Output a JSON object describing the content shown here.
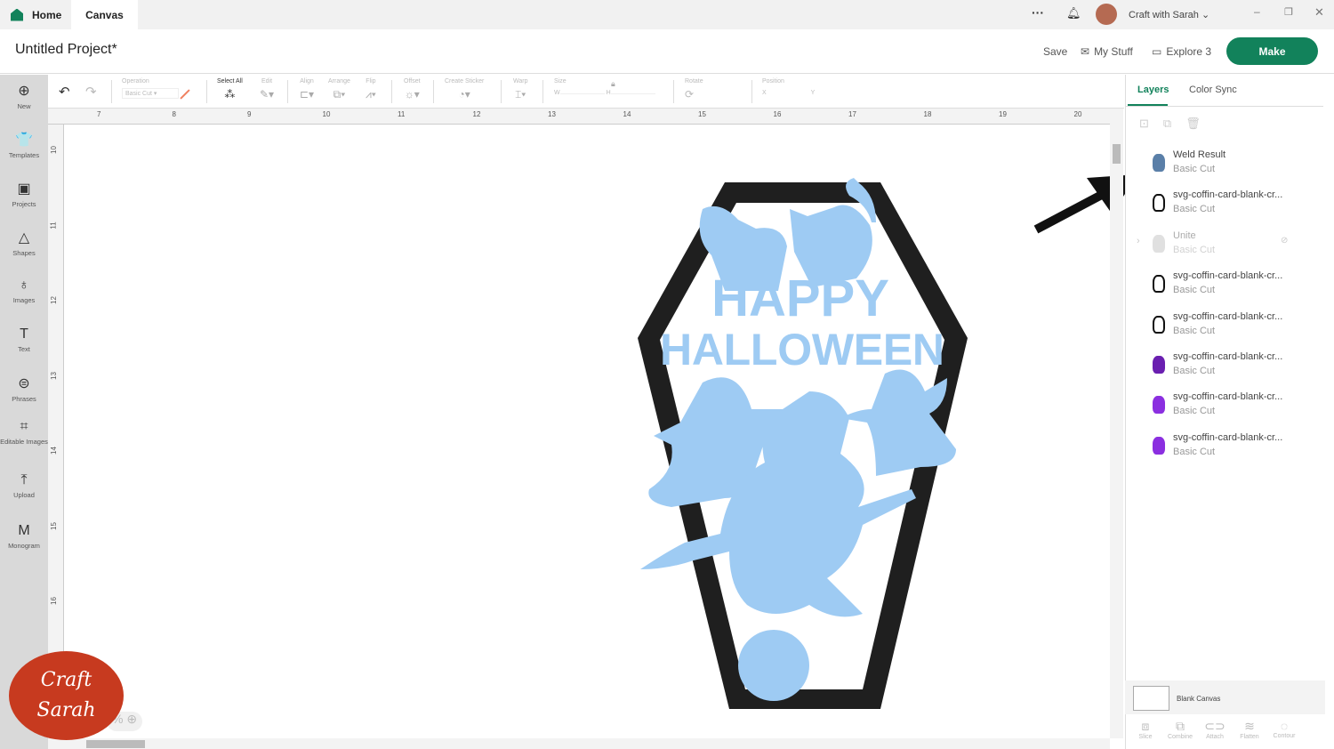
{
  "topbar": {
    "home": "Home",
    "canvas": "Canvas",
    "user": "Craft with Sarah"
  },
  "header": {
    "title": "Untitled Project*",
    "save": "Save",
    "my_stuff": "My Stuff",
    "machine": "Explore 3",
    "make": "Make"
  },
  "toolbar": {
    "operation": "Operation",
    "operation_value": "Basic Cut",
    "select_all": "Select All",
    "edit": "Edit",
    "align": "Align",
    "arrange": "Arrange",
    "flip": "Flip",
    "offset": "Offset",
    "create_sticker": "Create Sticker",
    "warp": "Warp",
    "size": "Size",
    "w": "W",
    "h": "H",
    "rotate": "Rotate",
    "position": "Position",
    "x": "X",
    "y": "Y"
  },
  "sidebar": {
    "items": [
      {
        "label": "New",
        "icon": "⊕"
      },
      {
        "label": "Templates",
        "icon": "👕"
      },
      {
        "label": "Projects",
        "icon": "▣"
      },
      {
        "label": "Shapes",
        "icon": "△"
      },
      {
        "label": "Images",
        "icon": "♁"
      },
      {
        "label": "Text",
        "icon": "T"
      },
      {
        "label": "Phrases",
        "icon": "⊜"
      },
      {
        "label": "Editable Images",
        "icon": "⌗"
      },
      {
        "label": "Upload",
        "icon": "⤒"
      },
      {
        "label": "Monogram",
        "icon": "M"
      }
    ]
  },
  "ruler": {
    "top": [
      "7",
      "8",
      "9",
      "10",
      "11",
      "12",
      "13",
      "14",
      "15",
      "16",
      "17",
      "18",
      "19",
      "20"
    ],
    "left": [
      "10",
      "11",
      "12",
      "13",
      "14",
      "15",
      "16"
    ]
  },
  "artwork": {
    "line1": "HAPPY",
    "line2": "HALLOWEEN",
    "colors": {
      "frame": "#1f1f1f",
      "fill": "#9ecbf3"
    }
  },
  "zoom": {
    "value": "%"
  },
  "panel": {
    "tabs": [
      "Layers",
      "Color Sync"
    ],
    "layers": [
      {
        "name": "Weld Result",
        "op": "Basic Cut",
        "color": "#5a7fa8"
      },
      {
        "name": "svg-coffin-card-blank-cr...",
        "op": "Basic Cut",
        "color": "#ffffff"
      },
      {
        "name": "Unite",
        "op": "Basic Cut",
        "color": "#bbbbbb",
        "hidden": true
      },
      {
        "name": "svg-coffin-card-blank-cr...",
        "op": "Basic Cut",
        "color": "#ffffff"
      },
      {
        "name": "svg-coffin-card-blank-cr...",
        "op": "Basic Cut",
        "color": "#ffffff"
      },
      {
        "name": "svg-coffin-card-blank-cr...",
        "op": "Basic Cut",
        "color": "#6a1fb0"
      },
      {
        "name": "svg-coffin-card-blank-cr...",
        "op": "Basic Cut",
        "color": "#8b2fe0"
      },
      {
        "name": "svg-coffin-card-blank-cr...",
        "op": "Basic Cut",
        "color": "#8b2fe0"
      }
    ],
    "canvas_label": "Blank Canvas",
    "bottom": [
      "Slice",
      "Combine",
      "Attach",
      "Flatten",
      "Contour"
    ]
  },
  "logo": {
    "text": "Craft with Sarah"
  },
  "colors": {
    "accent": "#12825b"
  }
}
